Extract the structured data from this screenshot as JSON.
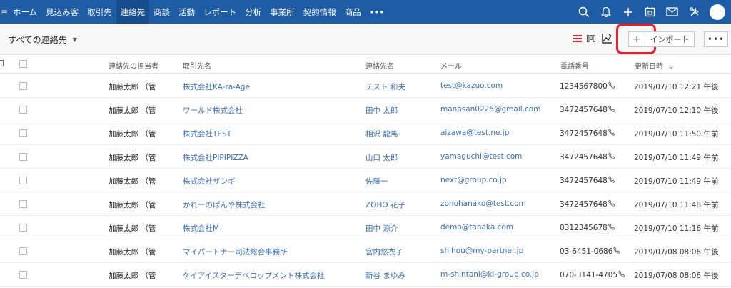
{
  "nav": {
    "menu_glyph": "≡",
    "items": [
      "ホーム",
      "見込み客",
      "取引先",
      "連絡先",
      "商談",
      "活動",
      "レポート",
      "分析",
      "事業所",
      "契約情報",
      "商品",
      "•••"
    ],
    "active_index": 3,
    "right_icons": [
      "search-icon",
      "bell-icon",
      "plus-icon",
      "calendar-icon",
      "mail-icon",
      "settings-icon",
      "avatar"
    ]
  },
  "toolbar": {
    "view_label": "すべての連絡先",
    "view_caret": "▼",
    "plus_label": "+",
    "import_label": "インポート",
    "more_label": "•••",
    "highlight_color": "#e0232c"
  },
  "table": {
    "headers": [
      "連絡先の担当者",
      "取引先名",
      "連絡先名",
      "メール",
      "電話番号",
      "更新日時"
    ],
    "sort_indicator": "⌄",
    "rows": [
      {
        "owner": "加藤太郎 （管",
        "account": "株式会社KA-ra-Age",
        "contact": "テスト 和夫",
        "email": "test@kazuo.com",
        "phone": "1234567800",
        "updated": "2019/07/10 12:21 午後"
      },
      {
        "owner": "加藤太郎 （管",
        "account": "ワールド株式会社",
        "contact": "田中 太郎",
        "email": "manasan0225@gmail.com",
        "phone": "3472457648",
        "updated": "2019/07/10 12:10 午後"
      },
      {
        "owner": "加藤太郎 （管",
        "account": "株式会社TEST",
        "contact": "相沢 龍馬",
        "email": "aizawa@test.ne.jp",
        "phone": "3472457648",
        "updated": "2019/07/10 11:50 午前"
      },
      {
        "owner": "加藤太郎 （管",
        "account": "株式会社PIPIPIZZA",
        "contact": "山口 太郎",
        "email": "yamaguchi@test.com",
        "phone": "3472457648",
        "updated": "2019/07/10 11:49 午前"
      },
      {
        "owner": "加藤太郎 （管",
        "account": "株式会社ザンギ",
        "contact": "佐藤一",
        "email": "next@group.co.jp",
        "phone": "3472457648",
        "updated": "2019/07/10 11:49 午前"
      },
      {
        "owner": "加藤太郎 （管",
        "account": "かれーのぱんや株式会社",
        "contact": "ZOHO 花子",
        "email": "zohohanako@test.com",
        "phone": "3472457648",
        "updated": "2019/07/10 11:48 午前"
      },
      {
        "owner": "加藤太郎 （管",
        "account": "株式会社M",
        "contact": "田中 涼介",
        "email": "demo@tanaka.com",
        "phone": "0312345678",
        "updated": "2019/07/10 11:16 午前"
      },
      {
        "owner": "加藤太郎 （管",
        "account": "マイパートナー司法総合事務所",
        "contact": "宮内悠衣子",
        "email": "shihou@my-partner.jp",
        "phone": "03-6451-0686",
        "updated": "2019/07/08 08:06 午後"
      },
      {
        "owner": "加藤太郎 （管",
        "account": "ケイアイスターデベロップメント株式会社",
        "contact": "新谷 まゆみ",
        "email": "m-shintani@ki-group.co.jp",
        "phone": "070-3141-4705",
        "updated": "2019/07/08 08:06 午後"
      }
    ]
  }
}
